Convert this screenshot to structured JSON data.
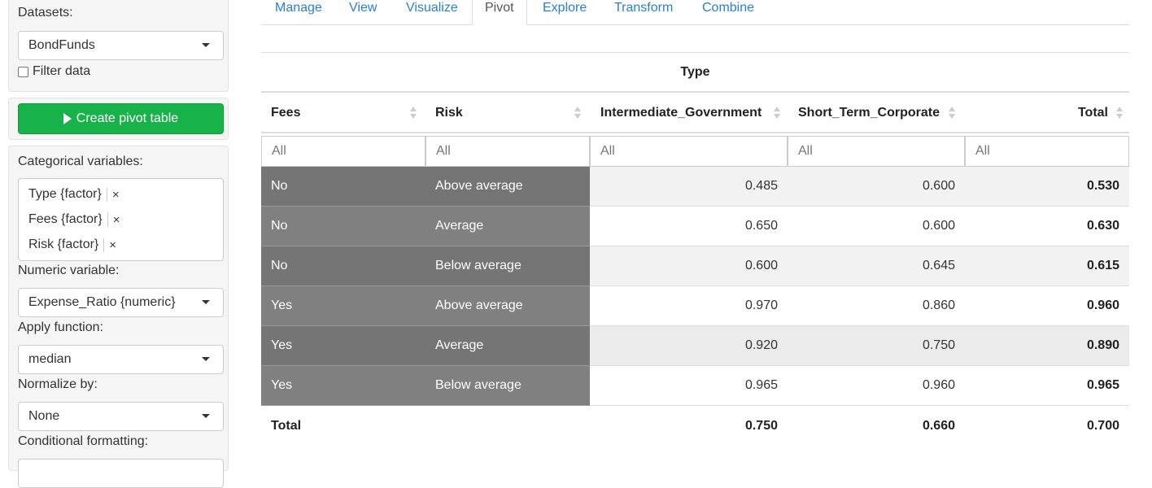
{
  "sidebar": {
    "datasets_label": "Datasets:",
    "dataset_value": "BondFunds",
    "filter_label": "Filter data",
    "create_button": "Create pivot table",
    "categorical_label": "Categorical variables:",
    "categorical_chips": [
      "Type {factor}",
      "Fees {factor}",
      "Risk {factor}"
    ],
    "chip_remove": "×",
    "numeric_label": "Numeric variable:",
    "numeric_value": "Expense_Ratio {numeric}",
    "function_label": "Apply function:",
    "function_value": "median",
    "normalize_label": "Normalize by:",
    "normalize_value": "None",
    "conditional_label": "Conditional formatting:"
  },
  "tabs": [
    "Manage",
    "View",
    "Visualize",
    "Pivot",
    "Explore",
    "Transform",
    "Combine"
  ],
  "active_tab": "Pivot",
  "pivot": {
    "group_header": "Type",
    "columns": [
      "Fees",
      "Risk",
      "Intermediate_Government",
      "Short_Term_Corporate",
      "Total"
    ],
    "filter_placeholder": "All",
    "rows": [
      {
        "fees": "No",
        "risk": "Above average",
        "ig": "0.485",
        "stc": "0.600",
        "total": "0.530"
      },
      {
        "fees": "No",
        "risk": "Average",
        "ig": "0.650",
        "stc": "0.600",
        "total": "0.630"
      },
      {
        "fees": "No",
        "risk": "Below average",
        "ig": "0.600",
        "stc": "0.645",
        "total": "0.615"
      },
      {
        "fees": "Yes",
        "risk": "Above average",
        "ig": "0.970",
        "stc": "0.860",
        "total": "0.960"
      },
      {
        "fees": "Yes",
        "risk": "Average",
        "ig": "0.920",
        "stc": "0.750",
        "total": "0.890"
      },
      {
        "fees": "Yes",
        "risk": "Below average",
        "ig": "0.965",
        "stc": "0.960",
        "total": "0.965"
      }
    ],
    "total_row": {
      "label": "Total",
      "ig": "0.750",
      "stc": "0.660",
      "total": "0.700"
    }
  },
  "colors": {
    "accent": "#2a7fd4",
    "create_button": "#17b24a",
    "category_cell": "#808080"
  }
}
